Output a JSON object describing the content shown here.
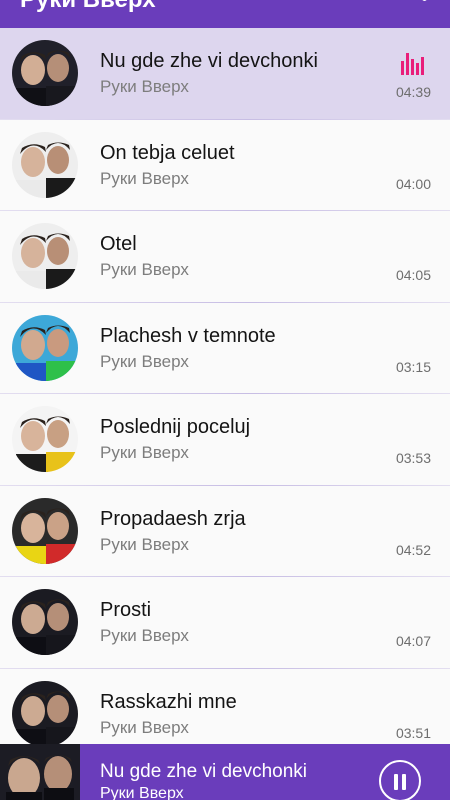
{
  "appbar": {
    "title": "Руки Вверх",
    "menu_icon": "more-vert-icon"
  },
  "colors": {
    "primary": "#6a3dbb",
    "active_row": "#ddd6ee",
    "playing_indicator": "#e91e7a"
  },
  "songs": [
    {
      "title": "Nu gde zhe vi devchonki",
      "artist": "Руки Вверх",
      "duration": "04:39",
      "active": true,
      "art": "portrait-night"
    },
    {
      "title": "On tebja celuet",
      "artist": "Руки Вверх",
      "duration": "04:00",
      "active": false,
      "art": "portrait-light"
    },
    {
      "title": "Otel",
      "artist": "Руки Вверх",
      "duration": "04:05",
      "active": false,
      "art": "portrait-light"
    },
    {
      "title": "Plachesh v temnote",
      "artist": "Руки Вверх",
      "duration": "03:15",
      "active": false,
      "art": "portrait-sky"
    },
    {
      "title": "Poslednij poceluj",
      "artist": "Руки Вверх",
      "duration": "03:53",
      "active": false,
      "art": "portrait-white"
    },
    {
      "title": "Propadaesh zrja",
      "artist": "Руки Вверх",
      "duration": "04:52",
      "active": false,
      "art": "portrait-yellow"
    },
    {
      "title": "Prosti",
      "artist": "Руки Вверх",
      "duration": "04:07",
      "active": false,
      "art": "portrait-dark"
    },
    {
      "title": "Rasskazhi mne",
      "artist": "Руки Вверх",
      "duration": "03:51",
      "active": false,
      "art": "portrait-dark"
    }
  ],
  "player": {
    "title": "Nu gde zhe vi devchonki",
    "artist": "Руки Вверх",
    "state_icon": "pause-icon"
  }
}
